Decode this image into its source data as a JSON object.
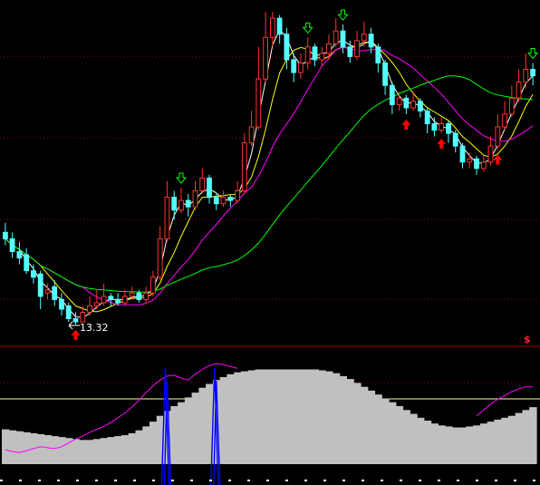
{
  "chart_data": {
    "type": "candlestick",
    "panels": [
      {
        "name": "price",
        "low_annotation": {
          "text": "13.32",
          "value": 13.32
        },
        "candles": [
          [
            0,
            16.2,
            16.0,
            16.5,
            15.8
          ],
          [
            1,
            16.0,
            15.6,
            16.2,
            15.4
          ],
          [
            2,
            15.6,
            15.4,
            15.9,
            15.2
          ],
          [
            3,
            15.5,
            15.0,
            15.7,
            14.9
          ],
          [
            4,
            15.0,
            14.8,
            15.2,
            14.6
          ],
          [
            5,
            14.9,
            14.2,
            15.0,
            13.8
          ],
          [
            6,
            14.3,
            14.4,
            14.6,
            14.1
          ],
          [
            7,
            14.5,
            14.1,
            14.7,
            13.9
          ],
          [
            8,
            14.1,
            13.8,
            14.3,
            13.6
          ],
          [
            9,
            13.9,
            13.5,
            14.0,
            13.4
          ],
          [
            10,
            13.5,
            13.4,
            13.7,
            13.32
          ],
          [
            11,
            13.4,
            13.7,
            13.9,
            13.4
          ],
          [
            12,
            13.7,
            13.9,
            14.2,
            13.6
          ],
          [
            13,
            13.9,
            14.0,
            14.4,
            13.8
          ],
          [
            14,
            14.0,
            14.2,
            14.6,
            13.9
          ],
          [
            15,
            14.2,
            14.1,
            14.3,
            13.9
          ],
          [
            16,
            14.1,
            14.0,
            14.3,
            13.9
          ],
          [
            17,
            14.0,
            14.2,
            14.4,
            13.9
          ],
          [
            18,
            14.2,
            14.3,
            14.5,
            14.1
          ],
          [
            19,
            14.3,
            14.1,
            14.4,
            14.0
          ],
          [
            20,
            14.1,
            14.3,
            14.5,
            14.0
          ],
          [
            21,
            14.3,
            14.8,
            15.0,
            14.2
          ],
          [
            22,
            14.8,
            16.0,
            16.4,
            14.7
          ],
          [
            23,
            16.0,
            17.3,
            17.8,
            15.9
          ],
          [
            24,
            17.3,
            16.9,
            17.5,
            16.6
          ],
          [
            25,
            16.9,
            17.2,
            17.6,
            16.8
          ],
          [
            26,
            17.2,
            17.0,
            17.4,
            16.7
          ],
          [
            27,
            17.0,
            17.5,
            17.8,
            16.9
          ],
          [
            28,
            17.5,
            17.9,
            18.2,
            17.4
          ],
          [
            29,
            17.9,
            17.3,
            18.0,
            17.1
          ],
          [
            30,
            17.3,
            17.1,
            17.4,
            16.9
          ],
          [
            31,
            17.1,
            17.3,
            17.5,
            17.0
          ],
          [
            32,
            17.3,
            17.2,
            17.4,
            17.0
          ],
          [
            33,
            17.2,
            17.5,
            17.8,
            17.1
          ],
          [
            34,
            17.5,
            19.0,
            19.3,
            17.4
          ],
          [
            35,
            19.0,
            19.5,
            20.0,
            18.9
          ],
          [
            36,
            19.5,
            21.0,
            22.0,
            19.4
          ],
          [
            37,
            21.0,
            22.3,
            23.1,
            20.9
          ],
          [
            38,
            22.3,
            22.9,
            23.1,
            22.0
          ],
          [
            39,
            22.9,
            22.4,
            23.0,
            22.1
          ],
          [
            40,
            22.4,
            21.6,
            22.6,
            21.3
          ],
          [
            41,
            21.6,
            21.2,
            21.8,
            20.9
          ],
          [
            42,
            21.2,
            21.5,
            21.8,
            21.0
          ],
          [
            43,
            21.5,
            22.0,
            22.3,
            21.3
          ],
          [
            44,
            22.0,
            21.6,
            22.1,
            21.4
          ],
          [
            45,
            21.6,
            21.8,
            22.0,
            21.4
          ],
          [
            46,
            21.8,
            22.1,
            22.4,
            21.6
          ],
          [
            47,
            22.1,
            22.5,
            22.9,
            22.0
          ],
          [
            48,
            22.5,
            22.0,
            22.7,
            21.8
          ],
          [
            49,
            22.0,
            21.7,
            22.2,
            21.5
          ],
          [
            50,
            21.7,
            22.2,
            22.5,
            21.6
          ],
          [
            51,
            22.2,
            22.4,
            22.8,
            22.0
          ],
          [
            52,
            22.4,
            22.0,
            22.6,
            21.8
          ],
          [
            53,
            22.0,
            21.5,
            22.1,
            21.2
          ],
          [
            54,
            21.5,
            20.8,
            21.6,
            20.5
          ],
          [
            55,
            20.8,
            20.2,
            20.9,
            19.9
          ],
          [
            56,
            20.2,
            20.4,
            20.6,
            20.0
          ],
          [
            57,
            20.4,
            20.1,
            20.5,
            19.9
          ],
          [
            58,
            20.1,
            20.3,
            20.6,
            20.0
          ],
          [
            59,
            20.3,
            20.0,
            20.4,
            19.8
          ],
          [
            60,
            20.0,
            19.6,
            20.1,
            19.3
          ],
          [
            61,
            19.6,
            19.4,
            19.8,
            19.2
          ],
          [
            62,
            19.4,
            19.6,
            19.8,
            19.3
          ],
          [
            63,
            19.6,
            19.3,
            19.7,
            19.0
          ],
          [
            64,
            19.3,
            18.9,
            19.4,
            18.7
          ],
          [
            65,
            18.9,
            18.4,
            19.0,
            18.2
          ],
          [
            66,
            18.4,
            18.5,
            18.7,
            18.2
          ],
          [
            67,
            18.5,
            18.2,
            18.6,
            18.0
          ],
          [
            68,
            18.2,
            18.4,
            18.6,
            18.1
          ],
          [
            69,
            18.4,
            18.9,
            19.2,
            18.3
          ],
          [
            70,
            18.9,
            19.5,
            19.9,
            18.8
          ],
          [
            71,
            19.5,
            19.9,
            20.3,
            19.4
          ],
          [
            72,
            19.9,
            20.4,
            20.8,
            19.8
          ],
          [
            73,
            20.4,
            20.9,
            21.3,
            20.3
          ],
          [
            74,
            20.9,
            21.3,
            21.8,
            20.7
          ],
          [
            75,
            21.3,
            21.1,
            21.5,
            20.8
          ]
        ],
        "buy_signal_bars": [
          10,
          57,
          62,
          70
        ],
        "sell_signal_bars": [
          25,
          43,
          48,
          75
        ],
        "ma_lines": [
          {
            "color": "#ffffff"
          },
          {
            "color": "#ffff00"
          },
          {
            "color": "#ff00ff"
          },
          {
            "color": "#00ff00"
          }
        ]
      },
      {
        "name": "indicator",
        "marker_text": "$",
        "area_color": "#c0c0c0",
        "line_color": "#ff00ff",
        "spike_color": "#0000ff",
        "area_values": [
          3.6,
          3.5,
          3.4,
          3.3,
          3.2,
          3.1,
          3.0,
          2.9,
          2.8,
          2.7,
          2.6,
          2.5,
          2.5,
          2.6,
          2.7,
          2.8,
          2.9,
          3.0,
          3.2,
          3.5,
          3.9,
          4.4,
          5.0,
          5.5,
          6.0,
          6.4,
          6.9,
          7.4,
          7.9,
          8.3,
          8.7,
          9.0,
          9.3,
          9.5,
          9.6,
          9.7,
          9.8,
          9.8,
          9.8,
          9.8,
          9.8,
          9.8,
          9.8,
          9.8,
          9.8,
          9.7,
          9.6,
          9.4,
          9.1,
          8.8,
          8.4,
          8.0,
          7.6,
          7.2,
          6.8,
          6.4,
          6.0,
          5.6,
          5.2,
          4.8,
          4.5,
          4.2,
          4.0,
          3.9,
          3.8,
          3.8,
          3.9,
          4.0,
          4.2,
          4.4,
          4.6,
          4.8,
          5.0,
          5.3,
          5.6,
          5.9
        ],
        "line_values": [
          1.5,
          1.3,
          1.2,
          1.4,
          1.6,
          1.8,
          1.7,
          1.6,
          1.8,
          2.2,
          2.6,
          2.9,
          3.3,
          3.6,
          3.9,
          4.3,
          4.8,
          5.3,
          5.9,
          6.6,
          7.4,
          8.1,
          8.7,
          9.1,
          9.2,
          8.9,
          8.7,
          9.3,
          9.8,
          10.2,
          10.4,
          10.3,
          10.1,
          9.9,
          null,
          null,
          null,
          null,
          null,
          null,
          null,
          null,
          null,
          null,
          null,
          null,
          null,
          null,
          null,
          null,
          null,
          null,
          null,
          null,
          null,
          null,
          null,
          null,
          null,
          null,
          null,
          null,
          null,
          null,
          null,
          null,
          null,
          5.0,
          5.6,
          6.2,
          6.7,
          7.1,
          7.5,
          7.8,
          8.0,
          8.0
        ],
        "spike_bars": [
          23,
          30
        ]
      }
    ]
  }
}
